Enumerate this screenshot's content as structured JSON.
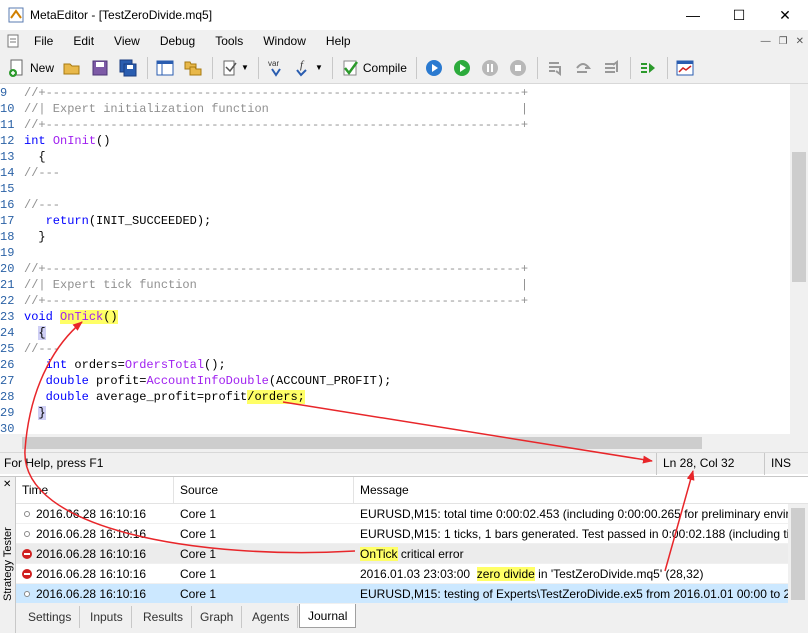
{
  "window": {
    "title": "MetaEditor - [TestZeroDivide.mq5]",
    "controls": {
      "minimize": "—",
      "maximize": "☐",
      "close": "✕"
    }
  },
  "menu": {
    "items": [
      "File",
      "Edit",
      "View",
      "Debug",
      "Tools",
      "Window",
      "Help"
    ],
    "mdi_controls": {
      "minimize": "—",
      "restore": "❐",
      "close": "✕"
    }
  },
  "toolbar": {
    "new_label": "New",
    "compile_label": "Compile",
    "var_label": "var",
    "func_label": "f"
  },
  "code": {
    "lines": [
      {
        "n": "9",
        "text": "//+------------------------------------------------------------------+"
      },
      {
        "n": "10",
        "text": "//| Expert initialization function                                   |"
      },
      {
        "n": "11",
        "text": "//+------------------------------------------------------------------+"
      },
      {
        "n": "12",
        "kw": "int",
        "fn": "OnInit",
        "rest": "()"
      },
      {
        "n": "13",
        "text": "  {"
      },
      {
        "n": "14",
        "text": "//---"
      },
      {
        "n": "15",
        "text": ""
      },
      {
        "n": "16",
        "text": "//---"
      },
      {
        "n": "17",
        "pre": "   ",
        "kw": "return",
        "rest": "(INIT_SUCCEEDED);"
      },
      {
        "n": "18",
        "text": "  }"
      },
      {
        "n": "19",
        "text": ""
      },
      {
        "n": "20",
        "text": "//+------------------------------------------------------------------+"
      },
      {
        "n": "21",
        "text": "//| Expert tick function                                             |"
      },
      {
        "n": "22",
        "text": "//+------------------------------------------------------------------+"
      },
      {
        "n": "23",
        "kw": "void",
        "fn": "OnTick",
        "rest": "()"
      },
      {
        "n": "24",
        "text": "  {"
      },
      {
        "n": "25",
        "text": "//---"
      },
      {
        "n": "26",
        "pre": "   ",
        "kw": "int",
        "mid": " orders=",
        "fn": "OrdersTotal",
        "rest": "();"
      },
      {
        "n": "27",
        "pre": "   ",
        "kw": "double",
        "mid": " profit=",
        "fn": "AccountInfoDouble",
        "rest": "(ACCOUNT_PROFIT);"
      },
      {
        "n": "28",
        "pre": "   ",
        "kw": "double",
        "mid": " average_profit=profit",
        "rest": "/orders;"
      },
      {
        "n": "29",
        "text": "  }"
      },
      {
        "n": "30",
        "text": ""
      }
    ]
  },
  "status": {
    "help": "For Help, press F1",
    "position": "Ln 28, Col 32",
    "mode": "INS"
  },
  "toolbox": {
    "panel_label": "Strategy Tester",
    "close": "✕",
    "columns": [
      "Time",
      "Source",
      "Message"
    ],
    "rows": [
      {
        "level": "info",
        "time": "2016.06.28 16:10:16",
        "source": "Core 1",
        "message": "EURUSD,M15: total time 0:00:02.453 (including 0:00:00.265 for preliminary envir..."
      },
      {
        "level": "info",
        "time": "2016.06.28 16:10:16",
        "source": "Core 1",
        "message": "EURUSD,M15: 1 ticks, 1 bars generated. Test passed in 0:00:02.188 (including tic..."
      },
      {
        "level": "error",
        "time": "2016.06.28 16:10:16",
        "source": "Core 1",
        "msg_hl": "OnTick",
        "msg_rest": " critical error"
      },
      {
        "level": "error",
        "time": "2016.06.28 16:10:16",
        "source": "Core 1",
        "msg_pre": "2016.01.03 23:03:00  ",
        "msg_hl": "zero divide",
        "msg_rest": " in 'TestZeroDivide.mq5' (28,32)"
      },
      {
        "level": "info",
        "time": "2016.06.28 16:10:16",
        "source": "Core 1",
        "message": "EURUSD,M15: testing of Experts\\TestZeroDivide.ex5 from 2016.01.01 00:00 to 20..."
      }
    ],
    "tabs": [
      "Settings",
      "Inputs",
      "Results",
      "Graph",
      "Agents",
      "Journal"
    ],
    "active_tab": "Journal"
  },
  "colors": {
    "annotation_arrow": "#e8262a",
    "highlight": "#ffff66"
  }
}
